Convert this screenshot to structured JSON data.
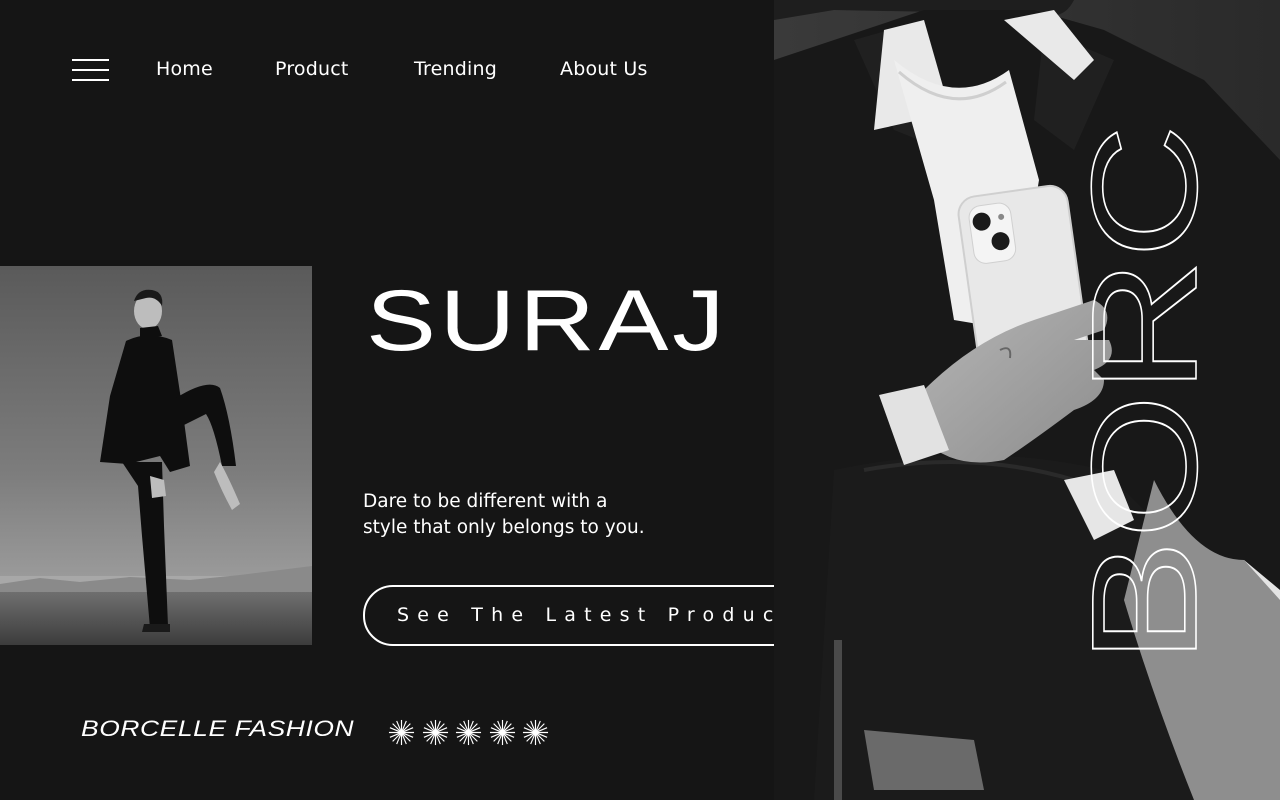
{
  "nav": {
    "menu_icon": "hamburger-menu-icon",
    "items": [
      {
        "label": "Home"
      },
      {
        "label": "Product"
      },
      {
        "label": "Trending"
      },
      {
        "label": "About Us"
      }
    ]
  },
  "hero": {
    "title": "SURAJ",
    "tagline_line1": "Dare to be different with a",
    "tagline_line2": "style that only belongs to you.",
    "cta_label": "See The Latest Product",
    "cta_icon": "arrow-left-icon"
  },
  "footer": {
    "brand": "BORCELLE FASHION",
    "sparkle_icon": "starburst-icon",
    "sparkle_count": 5
  },
  "side_text": "BORC",
  "colors": {
    "background": "#151515",
    "text": "#ffffff",
    "accent": "#ffffff"
  }
}
